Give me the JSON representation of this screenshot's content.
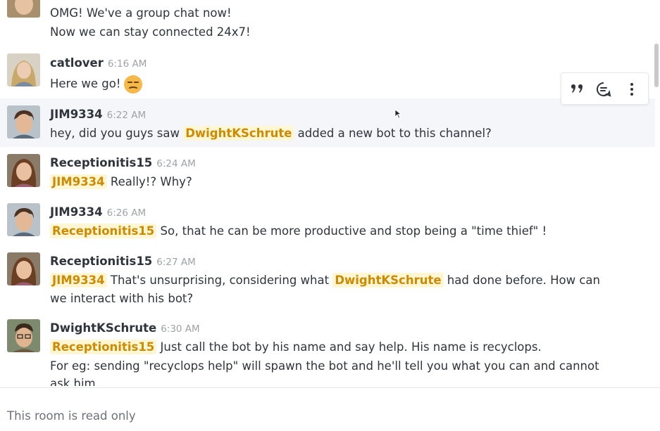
{
  "messages": [
    {
      "user": "",
      "time": "",
      "lines": [
        "OMG! We've a group chat now!",
        "Now we can stay connected 24x7!"
      ]
    },
    {
      "user": "catlover",
      "time": "6:16 AM",
      "text": "Here we go!",
      "emoji": "unamused-face-emoji"
    },
    {
      "user": "JIM9334",
      "time": "6:22 AM",
      "text_before": "hey, did you guys saw",
      "mention": "DwightKSchrute",
      "text_after": "added a new bot to this channel?"
    },
    {
      "user": "Receptionitis15",
      "time": "6:24 AM",
      "mention": "JIM9334",
      "text_after": "Really!? Why?"
    },
    {
      "user": "JIM9334",
      "time": "6:26 AM",
      "mention": "Receptionitis15",
      "text_after": "So, that he can be more productive and stop being a \"time thief\" !"
    },
    {
      "user": "Receptionitis15",
      "time": "6:27 AM",
      "mention": "JIM9334",
      "text_mid": "That's unsurprising, considering what",
      "mention2": "DwightKSchrute",
      "text_after": "had done before. How can",
      "line2": "we interact with his bot?"
    },
    {
      "user": "DwightKSchrute",
      "time": "6:30 AM",
      "mention": "Receptionitis15",
      "text_after": "Just call the bot by his name and say help. His name is recyclops.",
      "line2": "For eg: sending \"recyclops help\" will spawn the bot and he'll tell you what you can and cannot",
      "line3": "ask him."
    }
  ],
  "message_actions": [
    "quote-icon",
    "reply-in-thread-icon",
    "kebab-menu-icon"
  ],
  "footer": {
    "notice": "This room is read only"
  },
  "colors": {
    "mention_bg": "#fff6d4",
    "mention_text": "#ce8a00",
    "hover_bg": "#f4f6fa",
    "time": "#9ea2a8"
  }
}
